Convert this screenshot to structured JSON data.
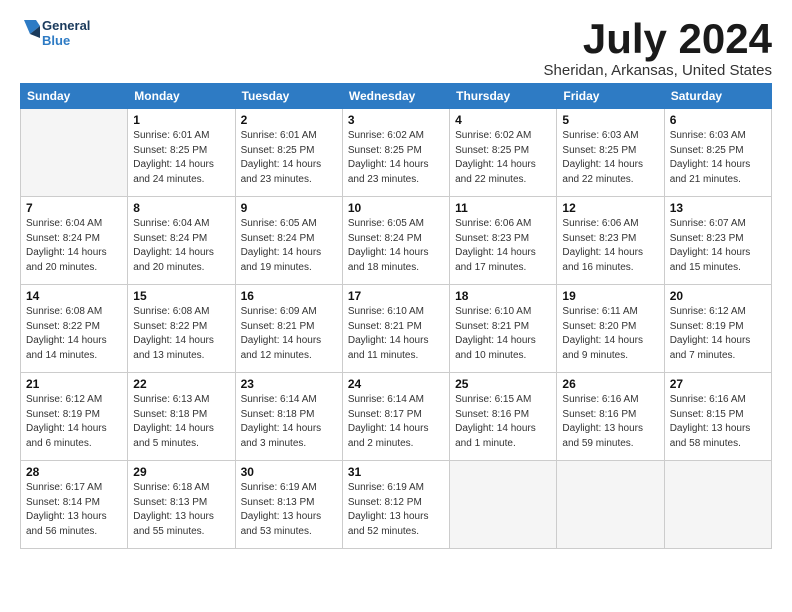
{
  "logo": {
    "line1": "General",
    "line2": "Blue"
  },
  "title": "July 2024",
  "location": "Sheridan, Arkansas, United States",
  "days_of_week": [
    "Sunday",
    "Monday",
    "Tuesday",
    "Wednesday",
    "Thursday",
    "Friday",
    "Saturday"
  ],
  "weeks": [
    [
      {
        "day": "",
        "info": ""
      },
      {
        "day": "1",
        "info": "Sunrise: 6:01 AM\nSunset: 8:25 PM\nDaylight: 14 hours\nand 24 minutes."
      },
      {
        "day": "2",
        "info": "Sunrise: 6:01 AM\nSunset: 8:25 PM\nDaylight: 14 hours\nand 23 minutes."
      },
      {
        "day": "3",
        "info": "Sunrise: 6:02 AM\nSunset: 8:25 PM\nDaylight: 14 hours\nand 23 minutes."
      },
      {
        "day": "4",
        "info": "Sunrise: 6:02 AM\nSunset: 8:25 PM\nDaylight: 14 hours\nand 22 minutes."
      },
      {
        "day": "5",
        "info": "Sunrise: 6:03 AM\nSunset: 8:25 PM\nDaylight: 14 hours\nand 22 minutes."
      },
      {
        "day": "6",
        "info": "Sunrise: 6:03 AM\nSunset: 8:25 PM\nDaylight: 14 hours\nand 21 minutes."
      }
    ],
    [
      {
        "day": "7",
        "info": "Sunrise: 6:04 AM\nSunset: 8:24 PM\nDaylight: 14 hours\nand 20 minutes."
      },
      {
        "day": "8",
        "info": "Sunrise: 6:04 AM\nSunset: 8:24 PM\nDaylight: 14 hours\nand 20 minutes."
      },
      {
        "day": "9",
        "info": "Sunrise: 6:05 AM\nSunset: 8:24 PM\nDaylight: 14 hours\nand 19 minutes."
      },
      {
        "day": "10",
        "info": "Sunrise: 6:05 AM\nSunset: 8:24 PM\nDaylight: 14 hours\nand 18 minutes."
      },
      {
        "day": "11",
        "info": "Sunrise: 6:06 AM\nSunset: 8:23 PM\nDaylight: 14 hours\nand 17 minutes."
      },
      {
        "day": "12",
        "info": "Sunrise: 6:06 AM\nSunset: 8:23 PM\nDaylight: 14 hours\nand 16 minutes."
      },
      {
        "day": "13",
        "info": "Sunrise: 6:07 AM\nSunset: 8:23 PM\nDaylight: 14 hours\nand 15 minutes."
      }
    ],
    [
      {
        "day": "14",
        "info": "Sunrise: 6:08 AM\nSunset: 8:22 PM\nDaylight: 14 hours\nand 14 minutes."
      },
      {
        "day": "15",
        "info": "Sunrise: 6:08 AM\nSunset: 8:22 PM\nDaylight: 14 hours\nand 13 minutes."
      },
      {
        "day": "16",
        "info": "Sunrise: 6:09 AM\nSunset: 8:21 PM\nDaylight: 14 hours\nand 12 minutes."
      },
      {
        "day": "17",
        "info": "Sunrise: 6:10 AM\nSunset: 8:21 PM\nDaylight: 14 hours\nand 11 minutes."
      },
      {
        "day": "18",
        "info": "Sunrise: 6:10 AM\nSunset: 8:21 PM\nDaylight: 14 hours\nand 10 minutes."
      },
      {
        "day": "19",
        "info": "Sunrise: 6:11 AM\nSunset: 8:20 PM\nDaylight: 14 hours\nand 9 minutes."
      },
      {
        "day": "20",
        "info": "Sunrise: 6:12 AM\nSunset: 8:19 PM\nDaylight: 14 hours\nand 7 minutes."
      }
    ],
    [
      {
        "day": "21",
        "info": "Sunrise: 6:12 AM\nSunset: 8:19 PM\nDaylight: 14 hours\nand 6 minutes."
      },
      {
        "day": "22",
        "info": "Sunrise: 6:13 AM\nSunset: 8:18 PM\nDaylight: 14 hours\nand 5 minutes."
      },
      {
        "day": "23",
        "info": "Sunrise: 6:14 AM\nSunset: 8:18 PM\nDaylight: 14 hours\nand 3 minutes."
      },
      {
        "day": "24",
        "info": "Sunrise: 6:14 AM\nSunset: 8:17 PM\nDaylight: 14 hours\nand 2 minutes."
      },
      {
        "day": "25",
        "info": "Sunrise: 6:15 AM\nSunset: 8:16 PM\nDaylight: 14 hours\nand 1 minute."
      },
      {
        "day": "26",
        "info": "Sunrise: 6:16 AM\nSunset: 8:16 PM\nDaylight: 13 hours\nand 59 minutes."
      },
      {
        "day": "27",
        "info": "Sunrise: 6:16 AM\nSunset: 8:15 PM\nDaylight: 13 hours\nand 58 minutes."
      }
    ],
    [
      {
        "day": "28",
        "info": "Sunrise: 6:17 AM\nSunset: 8:14 PM\nDaylight: 13 hours\nand 56 minutes."
      },
      {
        "day": "29",
        "info": "Sunrise: 6:18 AM\nSunset: 8:13 PM\nDaylight: 13 hours\nand 55 minutes."
      },
      {
        "day": "30",
        "info": "Sunrise: 6:19 AM\nSunset: 8:13 PM\nDaylight: 13 hours\nand 53 minutes."
      },
      {
        "day": "31",
        "info": "Sunrise: 6:19 AM\nSunset: 8:12 PM\nDaylight: 13 hours\nand 52 minutes."
      },
      {
        "day": "",
        "info": ""
      },
      {
        "day": "",
        "info": ""
      },
      {
        "day": "",
        "info": ""
      }
    ]
  ]
}
